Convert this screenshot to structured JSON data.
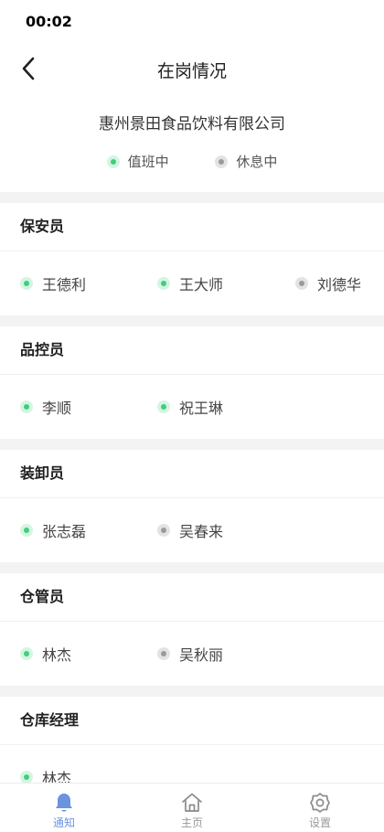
{
  "status_bar": {
    "time": "00:02"
  },
  "header": {
    "title": "在岗情况"
  },
  "company": "惠州景田食品饮料有限公司",
  "legend": {
    "on_duty": "值班中",
    "resting": "休息中"
  },
  "colors": {
    "on_duty": "#3fcf7d",
    "resting": "#9a9a9a",
    "active_tab": "#6c93e0"
  },
  "groups": [
    {
      "name": "保安员",
      "members": [
        {
          "name": "王德利",
          "status": "on_duty"
        },
        {
          "name": "王大师",
          "status": "on_duty"
        },
        {
          "name": "刘德华",
          "status": "resting"
        }
      ]
    },
    {
      "name": "品控员",
      "members": [
        {
          "name": "李顺",
          "status": "on_duty"
        },
        {
          "name": "祝王琳",
          "status": "on_duty"
        }
      ]
    },
    {
      "name": "装卸员",
      "members": [
        {
          "name": "张志磊",
          "status": "on_duty"
        },
        {
          "name": "吴春来",
          "status": "resting"
        }
      ]
    },
    {
      "name": "仓管员",
      "members": [
        {
          "name": "林杰",
          "status": "on_duty"
        },
        {
          "name": "吴秋丽",
          "status": "resting"
        }
      ]
    },
    {
      "name": "仓库经理",
      "members": [
        {
          "name": "林杰",
          "status": "on_duty"
        }
      ]
    }
  ],
  "tabbar": [
    {
      "label": "通知",
      "icon": "bell-icon",
      "active": true
    },
    {
      "label": "主页",
      "icon": "home-icon",
      "active": false
    },
    {
      "label": "设置",
      "icon": "gear-icon",
      "active": false
    }
  ]
}
